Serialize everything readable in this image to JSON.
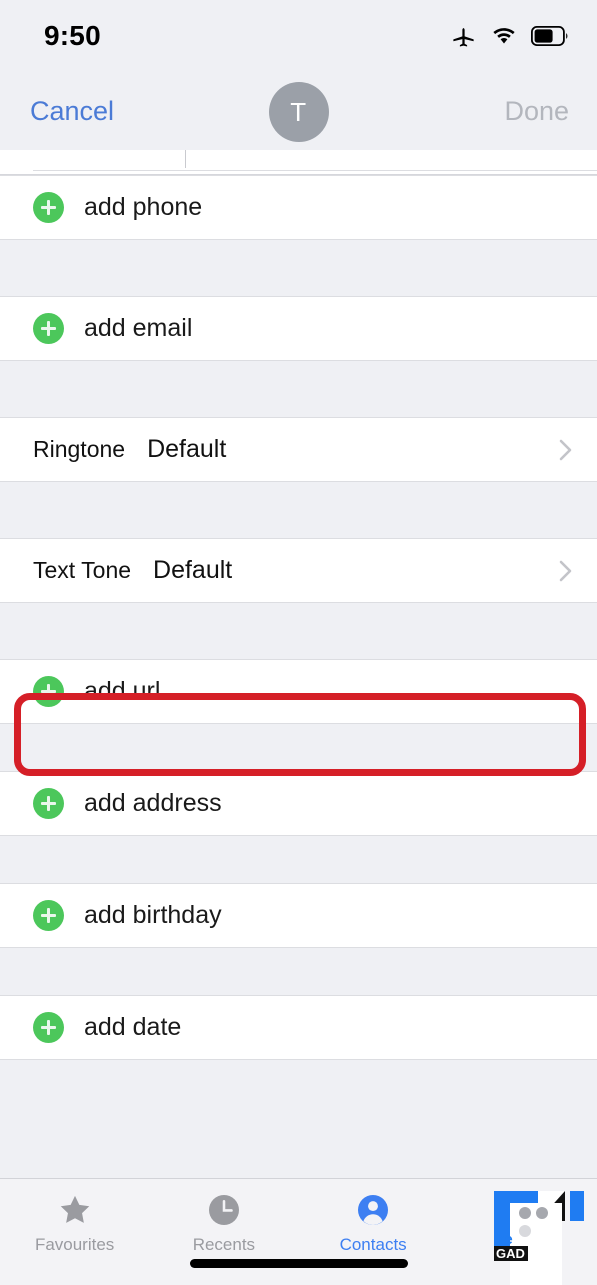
{
  "status_bar": {
    "time": "9:50",
    "icons": [
      "airplane-mode-icon",
      "wifi-icon",
      "battery-icon"
    ],
    "battery_level_pct": 62
  },
  "nav_bar": {
    "cancel_label": "Cancel",
    "done_label": "Done",
    "done_enabled": false,
    "avatar_initial": "T"
  },
  "rows": [
    {
      "id": "add-phone",
      "type": "add",
      "label": "add phone"
    },
    {
      "id": "add-email",
      "type": "add",
      "label": "add email"
    },
    {
      "id": "ringtone",
      "type": "value",
      "label": "Ringtone",
      "value": "Default"
    },
    {
      "id": "text-tone",
      "type": "value",
      "label": "Text Tone",
      "value": "Default",
      "highlighted": true
    },
    {
      "id": "add-url",
      "type": "add",
      "label": "add url"
    },
    {
      "id": "add-address",
      "type": "add",
      "label": "add address"
    },
    {
      "id": "add-birthday",
      "type": "add",
      "label": "add birthday"
    },
    {
      "id": "add-date",
      "type": "add",
      "label": "add date"
    }
  ],
  "tab_bar": {
    "tabs": [
      {
        "id": "favourites",
        "label": "Favourites",
        "icon": "star-icon",
        "active": false
      },
      {
        "id": "recents",
        "label": "Recents",
        "icon": "clock-icon",
        "active": false
      },
      {
        "id": "contacts",
        "label": "Contacts",
        "icon": "person-icon",
        "active": true
      },
      {
        "id": "keypad",
        "label": "",
        "icon": "keypad-icon",
        "active": false
      }
    ]
  },
  "overlay": {
    "watermark_text": "GAD",
    "note": "logo graphic covering fourth tab"
  },
  "colors": {
    "accent_blue": "#3d7ff2",
    "cancel_blue": "#4b7bd6",
    "add_green": "#4cc75b",
    "highlight_red": "#d51f27",
    "page_bg": "#eff0f4",
    "row_bg": "#ffffff",
    "muted_text": "#9a9ba0"
  }
}
